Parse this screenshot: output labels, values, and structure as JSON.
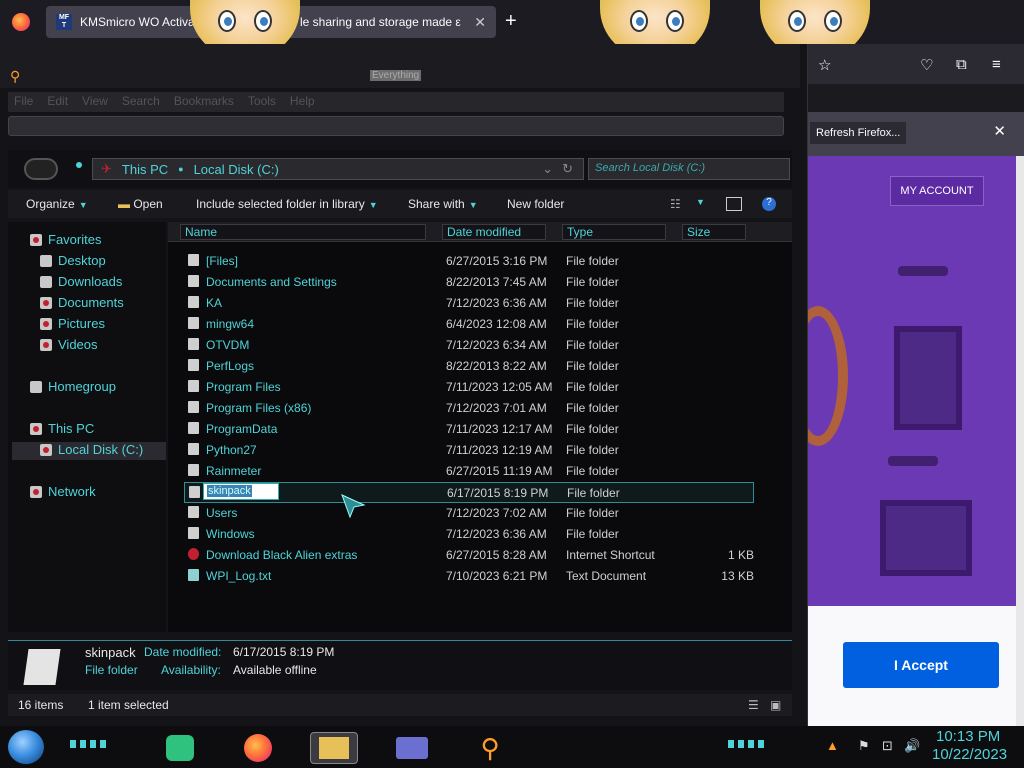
{
  "browser": {
    "tabs": [
      {
        "label": "KMSmicro WO Activa"
      },
      {
        "label": "le sharing and storage made ε"
      }
    ],
    "toolbar_icons": [
      "star-icon",
      "pocket-icon",
      "extensions-icon",
      "menu-icon"
    ],
    "notification": {
      "refresh_label": "Refresh Firefox..."
    },
    "web": {
      "my_account": "MY ACCOUNT",
      "accept": "I Accept"
    }
  },
  "everything": {
    "title": "Everything"
  },
  "menu": [
    "File",
    "Edit",
    "View",
    "Search",
    "Bookmarks",
    "Tools",
    "Help"
  ],
  "address": {
    "crumbs": [
      "This PC",
      "Local Disk (C:)"
    ],
    "search_placeholder": "Search Local Disk (C:)"
  },
  "toolbar": {
    "organize": "Organize",
    "open": "Open",
    "include": "Include selected folder in library",
    "share": "Share with",
    "new_folder": "New folder"
  },
  "nav": {
    "favorites": "Favorites",
    "desktop": "Desktop",
    "downloads": "Downloads",
    "documents": "Documents",
    "pictures": "Pictures",
    "videos": "Videos",
    "homegroup": "Homegroup",
    "this_pc": "This PC",
    "local_disk": "Local Disk (C:)",
    "network": "Network"
  },
  "columns": {
    "name": "Name",
    "date": "Date modified",
    "type": "Type",
    "size": "Size"
  },
  "files": [
    {
      "name": "[Files]",
      "date": "6/27/2015 3:16 PM",
      "type": "File folder",
      "size": ""
    },
    {
      "name": "Documents and Settings",
      "date": "8/22/2013 7:45 AM",
      "type": "File folder",
      "size": ""
    },
    {
      "name": "KA",
      "date": "7/12/2023 6:36 AM",
      "type": "File folder",
      "size": ""
    },
    {
      "name": "mingw64",
      "date": "6/4/2023 12:08 AM",
      "type": "File folder",
      "size": ""
    },
    {
      "name": "OTVDM",
      "date": "7/12/2023 6:34 AM",
      "type": "File folder",
      "size": ""
    },
    {
      "name": "PerfLogs",
      "date": "8/22/2013 8:22 AM",
      "type": "File folder",
      "size": ""
    },
    {
      "name": "Program Files",
      "date": "7/11/2023 12:05 AM",
      "type": "File folder",
      "size": ""
    },
    {
      "name": "Program Files (x86)",
      "date": "7/12/2023 7:01 AM",
      "type": "File folder",
      "size": ""
    },
    {
      "name": "ProgramData",
      "date": "7/11/2023 12:17 AM",
      "type": "File folder",
      "size": ""
    },
    {
      "name": "Python27",
      "date": "7/11/2023 12:19 AM",
      "type": "File folder",
      "size": ""
    },
    {
      "name": "Rainmeter",
      "date": "6/27/2015 11:19 AM",
      "type": "File folder",
      "size": ""
    },
    {
      "name": "skinpack",
      "date": "6/17/2015 8:19 PM",
      "type": "File folder",
      "size": ""
    },
    {
      "name": "Users",
      "date": "7/12/2023 7:02 AM",
      "type": "File folder",
      "size": ""
    },
    {
      "name": "Windows",
      "date": "7/12/2023 6:36 AM",
      "type": "File folder",
      "size": ""
    },
    {
      "name": "Download Black Alien extras",
      "date": "6/27/2015 8:28 AM",
      "type": "Internet Shortcut",
      "size": "1 KB"
    },
    {
      "name": "WPI_Log.txt",
      "date": "7/10/2023 6:21 PM",
      "type": "Text Document",
      "size": "13 KB"
    }
  ],
  "rename_value": "skinpack",
  "details": {
    "name": "skinpack",
    "date_label": "Date modified:",
    "date_value": "6/17/2015 8:19 PM",
    "type": "File folder",
    "avail_label": "Availability:",
    "avail_value": "Available offline"
  },
  "status": {
    "count": "16 items",
    "selected": "1 item selected"
  },
  "clock": {
    "time": "10:13 PM",
    "date": "10/22/2023"
  },
  "colors": {
    "accent": "#4fd3d8",
    "ff_blue": "#0060df",
    "web_purple": "#6b39b3"
  }
}
